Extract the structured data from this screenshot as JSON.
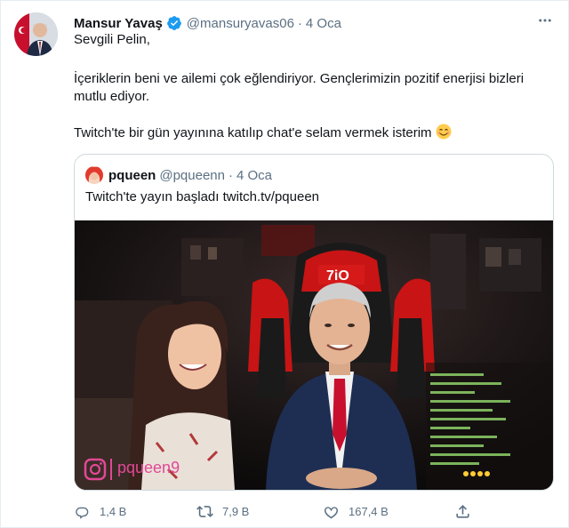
{
  "tweet": {
    "author_name": "Mansur Yavaş",
    "author_handle": "@mansuryavas06",
    "separator": "·",
    "date": "4 Oca",
    "greeting": "Sevgili Pelin,",
    "paragraph": "İçeriklerin beni ve ailemi çok eğlendiriyor. Gençlerimizin pozitif enerjisi bizleri mutlu ediyor.",
    "closing": "Twitch'te bir gün yayınına katılıp chat'e selam vermek isterim"
  },
  "quoted": {
    "author_name": "pqueen",
    "author_handle": "@pqueenn",
    "separator": "·",
    "date": "4 Oca",
    "text_prefix": "Twitch'te yayın başladı ",
    "link": "twitch.tv/pqueen",
    "media_watermark": "pqueen9"
  },
  "actions": {
    "reply_count": "1,4 B",
    "retweet_count": "7,9 B",
    "like_count": "167,4 B"
  },
  "colors": {
    "text": "#0f1419",
    "secondary": "#5b7083",
    "verified": "#1d9bf0",
    "border": "#cfd9de"
  },
  "icons": [
    "more-icon",
    "verified-badge-icon",
    "smile-emoji-icon",
    "reply-icon",
    "retweet-icon",
    "like-icon",
    "share-icon"
  ]
}
